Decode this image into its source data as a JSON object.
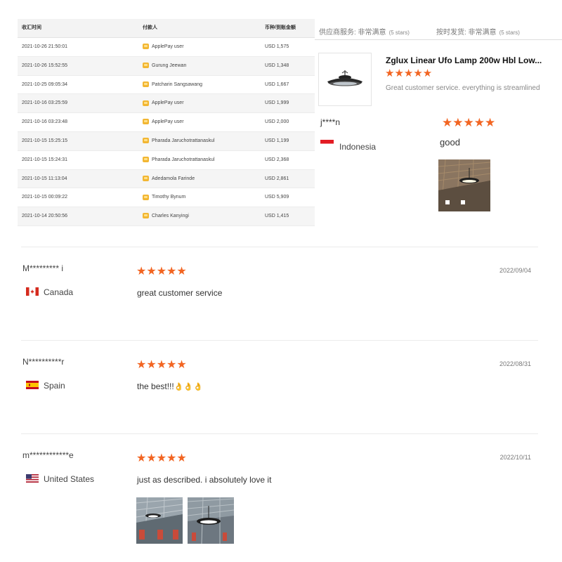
{
  "payment_table": {
    "headers": [
      "收汇时间",
      "付款人",
      "币种/到账金额"
    ],
    "rows": [
      {
        "time": "2021-10-26 21:50:01",
        "payer": "ApplePay user",
        "amount": "USD 1,575"
      },
      {
        "time": "2021-10-26 15:52:55",
        "payer": "Gurung Jeewan",
        "amount": "USD 1,348"
      },
      {
        "time": "2021-10-25 09:05:34",
        "payer": "Patcharin Sangsawang",
        "amount": "USD 1,667"
      },
      {
        "time": "2021-10-16 03:25:59",
        "payer": "ApplePay user",
        "amount": "USD 1,999"
      },
      {
        "time": "2021-10-16 03:23:48",
        "payer": "ApplePay user",
        "amount": "USD 2,000"
      },
      {
        "time": "2021-10-15 15:25:15",
        "payer": "Pharada Jaruchotrattanaskul",
        "amount": "USD 1,199"
      },
      {
        "time": "2021-10-15 15:24:31",
        "payer": "Pharada Jaruchotrattanaskul",
        "amount": "USD 2,368"
      },
      {
        "time": "2021-10-15 11:13:04",
        "payer": "Adedamola Farinde",
        "amount": "USD 2,861"
      },
      {
        "time": "2021-10-15 00:09:22",
        "payer": "Timothy Bynum",
        "amount": "USD 5,909"
      },
      {
        "time": "2021-10-14 20:50:56",
        "payer": "Charles Kanyingi",
        "amount": "USD 1,415"
      }
    ]
  },
  "supplier_ratings": {
    "service_label": "供应商服务: 非常满意",
    "service_stars": "(5 stars)",
    "delivery_label": "按时发货: 非常满意",
    "delivery_stars": "(5 stars)"
  },
  "product": {
    "title": "Zglux Linear Ufo Lamp 200w Hbl Low...",
    "stars": "★★★★★",
    "description": "Great customer service. everything is streamlined"
  },
  "top_review": {
    "user": "j****n",
    "country": "Indonesia",
    "stars": "★★★★★",
    "text": "good"
  },
  "reviews": [
    {
      "user": "M********* i",
      "country": "Canada",
      "stars": "★★★★★",
      "date": "2022/09/04",
      "text": "great customer service"
    },
    {
      "user": "N**********r",
      "country": "Spain",
      "stars": "★★★★★",
      "date": "2022/08/31",
      "text": "the best!!!",
      "emoji": "👌👌👌"
    },
    {
      "user": "m************e",
      "country": "United States",
      "stars": "★★★★★",
      "date": "2022/10/11",
      "text": "just as described. i absolutely love it"
    }
  ],
  "colors": {
    "star": "#f26522",
    "payer_icon": "#f2b632"
  }
}
